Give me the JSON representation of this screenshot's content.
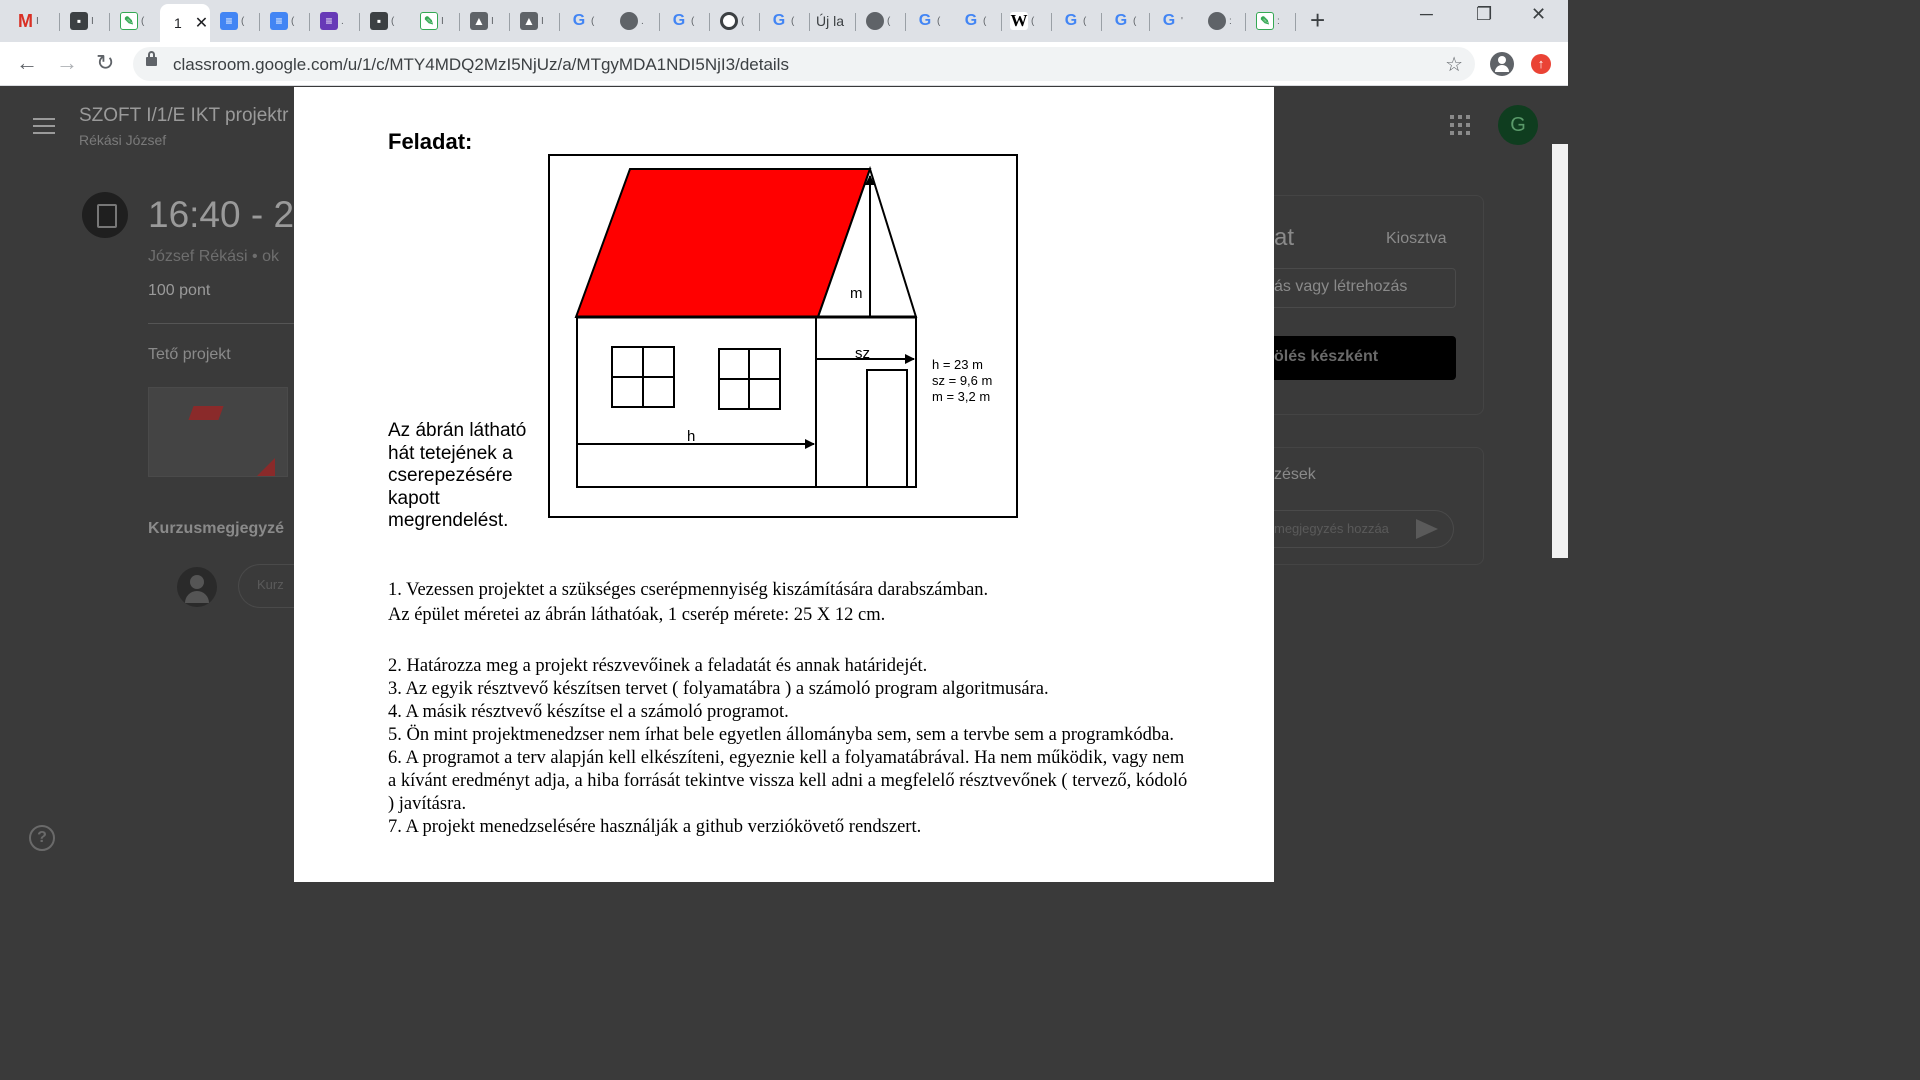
{
  "browser": {
    "tabs": [
      {
        "icon": "gmail-icon",
        "label": "M"
      },
      {
        "icon": "contact-card-icon",
        "label": ""
      },
      {
        "icon": "spreadsheet-icon",
        "label": ""
      },
      {
        "icon": "active",
        "label": "1"
      },
      {
        "icon": "google-docs-icon",
        "label": ""
      },
      {
        "icon": "google-docs-icon",
        "label": ""
      },
      {
        "icon": "google-forms-icon",
        "label": ""
      },
      {
        "icon": "contact-card-icon",
        "label": ""
      },
      {
        "icon": "spreadsheet-icon",
        "label": ""
      },
      {
        "icon": "image-icon",
        "label": ""
      },
      {
        "icon": "image-icon",
        "label": ""
      },
      {
        "icon": "google-icon",
        "label": "G"
      },
      {
        "icon": "globe-icon",
        "label": ""
      },
      {
        "icon": "google-icon",
        "label": "G"
      },
      {
        "icon": "chat-icon",
        "label": ""
      },
      {
        "icon": "google-icon",
        "label": "G"
      },
      {
        "icon": "new-tab",
        "label": "Új la"
      },
      {
        "icon": "globe-icon",
        "label": ""
      },
      {
        "icon": "google-icon",
        "label": "G"
      },
      {
        "icon": "google-icon",
        "label": "G"
      },
      {
        "icon": "wikipedia-icon",
        "label": "W"
      },
      {
        "icon": "google-icon",
        "label": "G"
      },
      {
        "icon": "google-icon",
        "label": "G"
      },
      {
        "icon": "google-icon",
        "label": "G"
      },
      {
        "icon": "globe-icon",
        "label": ""
      },
      {
        "icon": "spreadsheet-icon",
        "label": ""
      }
    ],
    "active_tab_label": "1",
    "url": "classroom.google.com/u/1/c/MTY4MDQ2MzI5NjUz/a/MTgyMDA1NDI5NjI3/details"
  },
  "classroom": {
    "course_title": "SZOFT I/1/E IKT projektr",
    "course_teacher": "Rékási József",
    "assignment_title": "16:40 - 2",
    "assignment_meta": "József Rékási • ok",
    "points": "100 pont",
    "description": "Tető projekt",
    "class_comments": "Kurzusmegjegyzé",
    "comment_placeholder": "Kurz",
    "account_initial": "G",
    "work_card_title": "at",
    "work_card_status": "Kiosztva",
    "work_card_add": "ás vagy létrehozás",
    "work_card_done": "ölés készként",
    "private_card_title": "zések",
    "private_placeholder": "megjegyzés hozzáa",
    "help_icon": "?"
  },
  "document": {
    "heading": "Feladat:",
    "caption": "Az ábrán látható hát tetejének a cserepezésére kapott megrendelést.",
    "figure": {
      "label_m": "m",
      "label_sz": "sz",
      "label_h": "h",
      "dims": [
        "h = 23 m",
        "sz = 9,6 m",
        "m = 3,2 m"
      ],
      "roof_color": "#ff0000"
    },
    "items": [
      "1. Vezessen projektet a szükséges cserépmennyiség kiszámítására darabszámban.",
      "Az épület méretei az ábrán láthatóak, 1 cserép mérete: 25 X 12 cm.",
      "2. Határozza meg a projekt részvevőinek a feladatát és annak határidejét.",
      "3. Az egyik résztvevő készítsen tervet ( folyamatábra ) a számoló program algoritmusára.",
      "4. A másik résztvevő készítse el a számoló programot.",
      "5. Ön mint projektmenedzser nem írhat bele egyetlen állományba sem, sem a tervbe sem a programkódba.",
      "6. A programot a terv alapján kell elkészíteni, egyeznie kell a folyamatábrával. Ha nem működik, vagy nem a kívánt eredményt adja, a hiba forrását tekintve vissza kell adni a megfelelő résztvevőnek ( tervező, kódoló ) javításra.",
      "7. A projekt menedzselésére használják a github verziókövető rendszert."
    ]
  }
}
